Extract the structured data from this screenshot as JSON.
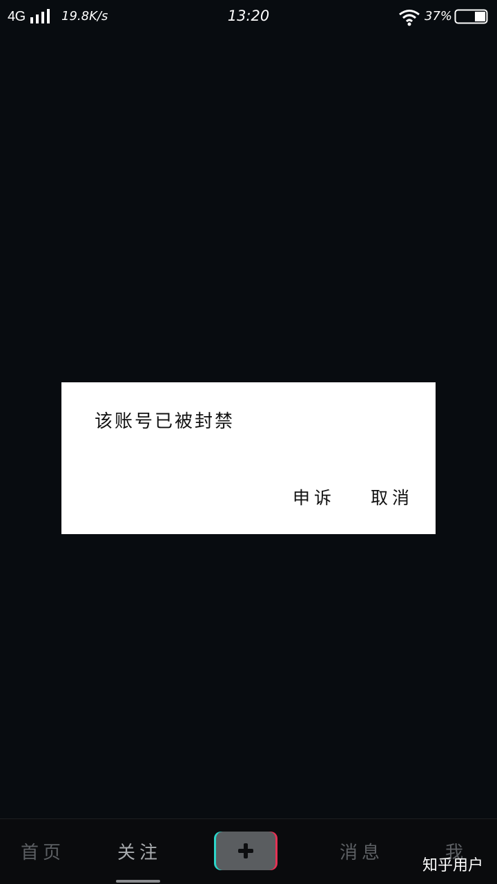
{
  "status_bar": {
    "network": "4G",
    "speed": "19.8K/s",
    "time": "13:20",
    "battery_percent": "37%",
    "icons": [
      "signal-icon",
      "wifi-icon",
      "battery-icon"
    ]
  },
  "dialog": {
    "message": "该账号已被封禁",
    "appeal_label": "申诉",
    "cancel_label": "取消"
  },
  "bottom_nav": {
    "home_label": "首页",
    "follow_label": "关注",
    "add_icon": "plus-icon",
    "messages_label": "消息",
    "me_label": "我",
    "active": "关注"
  },
  "watermark": "知乎用户",
  "colors": {
    "background": "#080c10",
    "dialog_background": "#ffffff",
    "accent_cyan": "#2bd6c9",
    "accent_red": "#e63154"
  }
}
